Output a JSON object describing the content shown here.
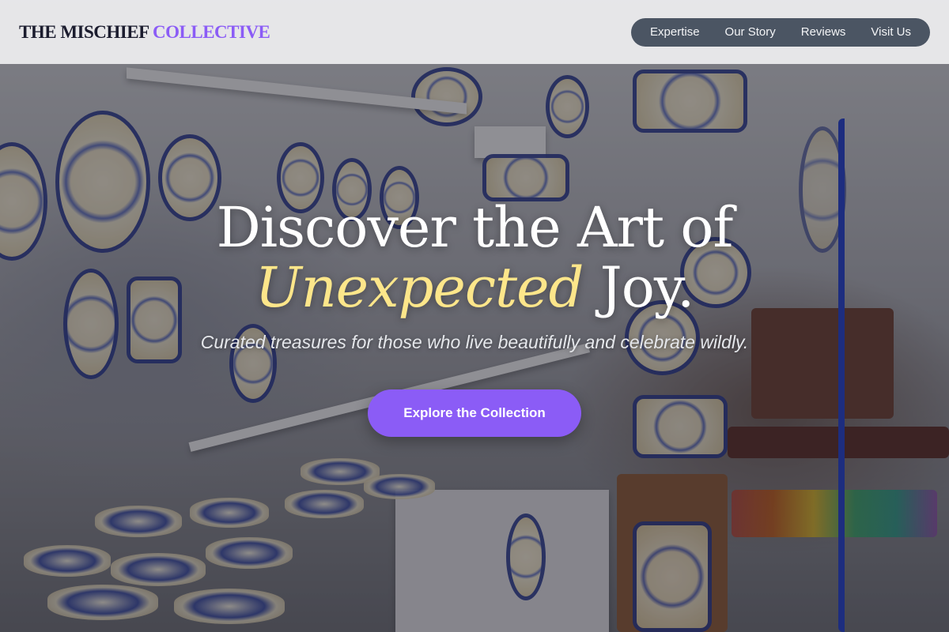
{
  "brand": {
    "name_part1": "THE MISCHIEF",
    "name_part2": "COLLECTIVE"
  },
  "nav": {
    "items": [
      {
        "label": "Expertise"
      },
      {
        "label": "Our Story"
      },
      {
        "label": "Reviews"
      },
      {
        "label": "Visit Us"
      }
    ]
  },
  "hero": {
    "headline_line1": "Discover the Art of",
    "headline_accent": "Unexpected",
    "headline_end": "Joy.",
    "tagline": "Curated treasures for those who live beautifully and celebrate wildly.",
    "cta_label": "Explore the Collection",
    "background_image": "ceramics-shop-photo"
  },
  "colors": {
    "accent": "#8b5cf6",
    "headline_accent": "#fde68a",
    "nav_bg": "#4b5563",
    "brand_dark": "#1b1c2e"
  }
}
